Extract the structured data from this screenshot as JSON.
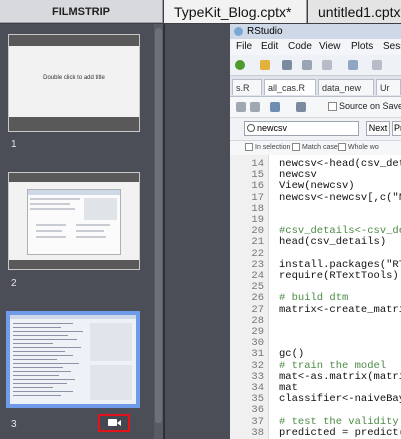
{
  "tabs": {
    "filmstrip": "FILMSTRIP",
    "doc1": "TypeKit_Blog.cptx*",
    "doc2": "untitled1.cptx*"
  },
  "filmstrip": {
    "slides": [
      {
        "number": "1",
        "title": "Double click to add title"
      },
      {
        "number": "2"
      },
      {
        "number": "3",
        "selected": true,
        "icon": "video-camera-icon"
      }
    ]
  },
  "rstudio": {
    "title": "RStudio",
    "menu": [
      "File",
      "Edit",
      "Code",
      "View",
      "Plots",
      "Sess"
    ],
    "file_tabs": [
      "s.R",
      "all_cas.R",
      "data_new",
      "Ur"
    ],
    "source_on_save": "Source on Save",
    "find": {
      "value": "newcsv",
      "next": "Next",
      "prev": "Pr"
    },
    "options": [
      "In selection",
      "Match case",
      "Whole wo"
    ],
    "code": [
      {
        "n": "14",
        "t": "newcsv<-head(csv_deta"
      },
      {
        "n": "15",
        "t": "newcsv"
      },
      {
        "n": "16",
        "t": "View(newcsv)"
      },
      {
        "n": "17",
        "t": "newcsv<-newcsv[,c(\"No"
      },
      {
        "n": "18",
        "t": ""
      },
      {
        "n": "19",
        "t": ""
      },
      {
        "n": "20",
        "t": "#csv_details<-csv_det"
      },
      {
        "n": "21",
        "t": "head(csv_details)"
      },
      {
        "n": "22",
        "t": ""
      },
      {
        "n": "23",
        "t": "install.packages(\"RTe"
      },
      {
        "n": "24",
        "t": "require(RTextTools)"
      },
      {
        "n": "25",
        "t": ""
      },
      {
        "n": "26",
        "t": "# build dtm"
      },
      {
        "n": "27",
        "t": "matrix<-create_matrix"
      },
      {
        "n": "28",
        "t": ""
      },
      {
        "n": "29",
        "t": ""
      },
      {
        "n": "30",
        "t": ""
      },
      {
        "n": "31",
        "t": "gc()"
      },
      {
        "n": "32",
        "t": "# train the model"
      },
      {
        "n": "33",
        "t": "mat<-as.matrix(matrix"
      },
      {
        "n": "34",
        "t": "mat"
      },
      {
        "n": "35",
        "t": "classifier<-naiveBaye"
      },
      {
        "n": "36",
        "t": ""
      },
      {
        "n": "37",
        "t": "# test the validity"
      },
      {
        "n": "38",
        "t": "predicted = predict(c"
      }
    ]
  },
  "colors": {
    "selection": "#6f9be8",
    "highlight_box": "#e4121b",
    "comment": "#4c8b45"
  }
}
